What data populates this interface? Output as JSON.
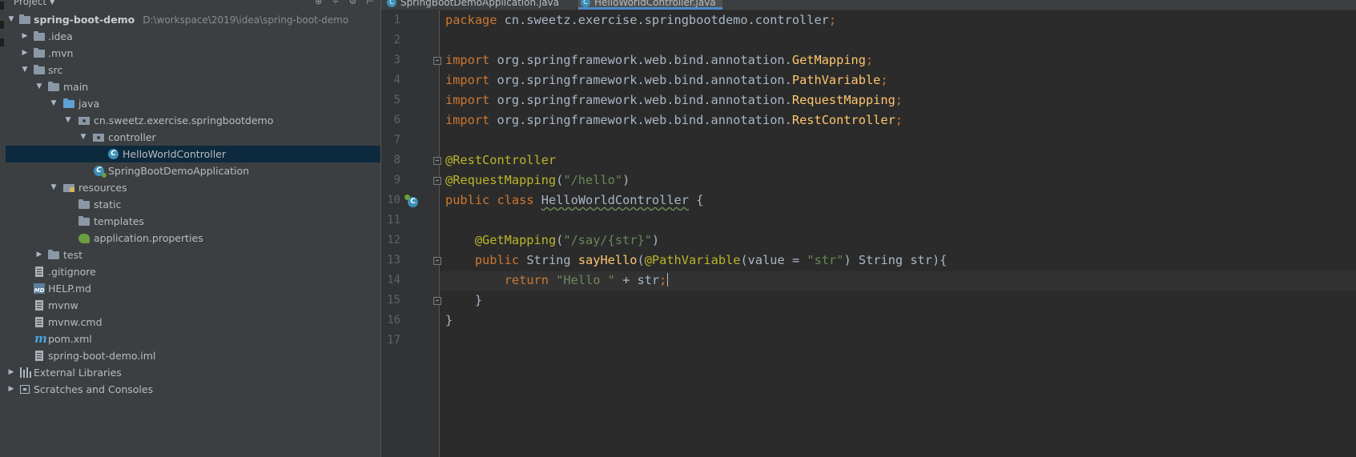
{
  "project_panel": {
    "title": "Project",
    "tools": [
      "⊕",
      "÷",
      "⚙",
      "⊢"
    ],
    "root": {
      "name": "spring-boot-demo",
      "path": "D:\\workspace\\2019\\idea\\spring-boot-demo"
    },
    "items": {
      "idea": ".idea",
      "mvn": ".mvn",
      "src": "src",
      "main": "main",
      "java": "java",
      "package": "cn.sweetz.exercise.springbootdemo",
      "controller": "controller",
      "hello_controller": "HelloWorldController",
      "app_class": "SpringBootDemoApplication",
      "resources": "resources",
      "static": "static",
      "templates": "templates",
      "app_props": "application.properties",
      "test": "test",
      "gitignore": ".gitignore",
      "help_md": "HELP.md",
      "mvnw": "mvnw",
      "mvnw_cmd": "mvnw.cmd",
      "pom": "pom.xml",
      "iml": "spring-boot-demo.iml",
      "ext_libs": "External Libraries",
      "scratches": "Scratches and Consoles"
    }
  },
  "editor": {
    "tabs": [
      {
        "label": "SpringBootDemoApplication.java",
        "active": false
      },
      {
        "label": "HelloWorldController.java",
        "active": true
      }
    ],
    "line_numbers": [
      "1",
      "2",
      "3",
      "4",
      "5",
      "6",
      "7",
      "8",
      "9",
      "10",
      "11",
      "12",
      "13",
      "14",
      "15",
      "16",
      "17"
    ],
    "code": {
      "l1_kw": "package",
      "l1_rest": " cn.sweetz.exercise.springbootdemo.controller",
      "semi": ";",
      "import_kw": "import",
      "import_prefix": " org.springframework.web.bind.annotation.",
      "imports": [
        "GetMapping",
        "PathVariable",
        "RequestMapping",
        "RestController"
      ],
      "ann_restcontroller": "@RestController",
      "ann_requestmapping": "@RequestMapping",
      "str_hello_path": "\"/hello\"",
      "public": "public",
      "class": "class",
      "class_name": "HelloWorldController",
      "open_brace": " {",
      "ann_getmapping": "@GetMapping",
      "str_say_path": "\"/say/{str}\"",
      "string_type": "String",
      "method_name": "sayHello",
      "ann_pathvariable": "@PathVariable",
      "param_value": "value",
      "equals": " = ",
      "str_str": "\"str\"",
      "param_tail": " String str){",
      "return_kw": "return",
      "str_hello": "\"Hello \"",
      "concat": " + str",
      "close_brace": "}"
    }
  },
  "colors": {
    "keyword": "#cc7832",
    "annotation": "#bbb529",
    "string": "#6a8759",
    "method": "#ffc66d",
    "selection": "#0d293e"
  }
}
